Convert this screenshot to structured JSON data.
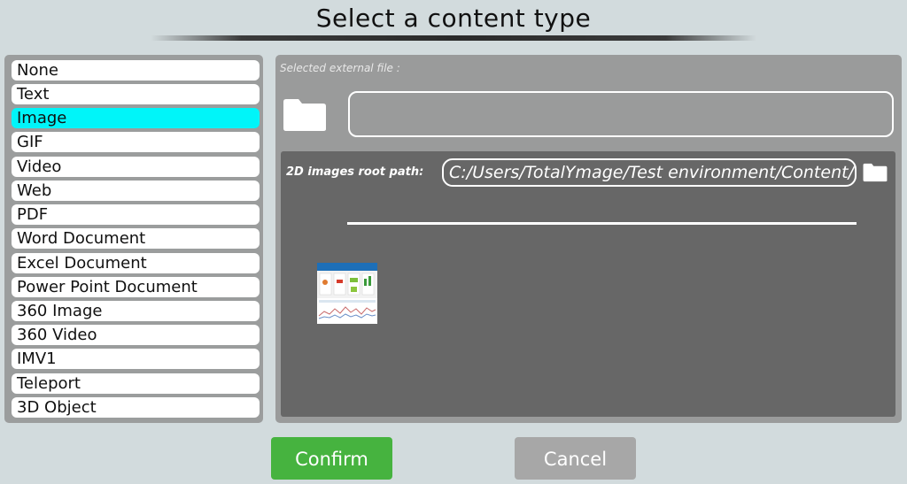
{
  "dialog": {
    "title": "Select a content type"
  },
  "content_types": [
    {
      "label": "None",
      "selected": false
    },
    {
      "label": "Text",
      "selected": false
    },
    {
      "label": "Image",
      "selected": true
    },
    {
      "label": "GIF",
      "selected": false
    },
    {
      "label": "Video",
      "selected": false
    },
    {
      "label": "Web",
      "selected": false
    },
    {
      "label": "PDF",
      "selected": false
    },
    {
      "label": "Word Document",
      "selected": false
    },
    {
      "label": "Excel Document",
      "selected": false
    },
    {
      "label": "Power Point Document",
      "selected": false
    },
    {
      "label": "360 Image",
      "selected": false
    },
    {
      "label": "360 Video",
      "selected": false
    },
    {
      "label": "IMV1",
      "selected": false
    },
    {
      "label": "Teleport",
      "selected": false
    },
    {
      "label": "3D Object",
      "selected": false
    }
  ],
  "external": {
    "label": "Selected external file :",
    "value": "",
    "icon": "folder-icon"
  },
  "images_root": {
    "label": "2D images root path:",
    "value": "C:/Users/TotalYmage/Test environment/Content/",
    "icon": "folder-icon"
  },
  "buttons": {
    "confirm": "Confirm",
    "cancel": "Cancel"
  },
  "colors": {
    "selected": "#00f5f9",
    "confirm": "#46b33f",
    "cancel": "#a7a7a7",
    "background": "#d2dbdd"
  }
}
